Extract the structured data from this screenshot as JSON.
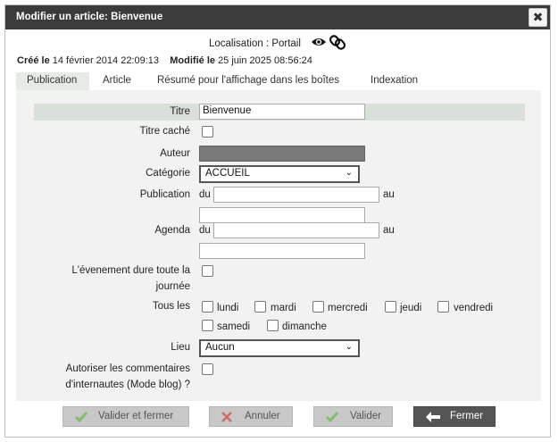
{
  "dialog": {
    "title": "Modifier un article: Bienvenue",
    "close_glyph": "✖",
    "location_text": "Localisation : Portail",
    "created_label": "Créé le",
    "created_value": "14 février 2014 22:09:13",
    "modified_label": "Modifié le",
    "modified_value": "25 juin 2025 08:56:24"
  },
  "tabs": [
    "Publication",
    "Article",
    "Résumé pour l'affichage dans les boîtes",
    "Indexation"
  ],
  "form": {
    "titre_label": "Titre",
    "titre_value": "Bienvenue",
    "titre_cache_label": "Titre caché",
    "auteur_label": "Auteur",
    "categorie_label": "Catégorie",
    "categorie_value": "ACCUEIL",
    "publication_label": "Publication",
    "du": "du",
    "au": "au",
    "agenda_label": "Agenda",
    "evenement_label_1": "L'évenement dure toute la",
    "evenement_label_2": "journée",
    "tous_les_label": "Tous les",
    "days": [
      "lundi",
      "mardi",
      "mercredi",
      "jeudi",
      "vendredi",
      "samedi",
      "dimanche"
    ],
    "lieu_label": "Lieu",
    "lieu_value": "Aucun",
    "comments_label_1": "Autoriser les commentaires",
    "comments_label_2": "d'internautes (Mode blog) ?"
  },
  "buttons": {
    "save_close": "Valider et fermer",
    "cancel": "Annuler",
    "save": "Valider",
    "close": "Fermer"
  },
  "icons": {
    "eye": "eye-icon",
    "link": "link-icon",
    "check": "check-icon",
    "cross": "cross-icon",
    "back_arrow": "back-arrow-icon"
  },
  "colors": {
    "titlebar": "#3b3b3b",
    "panel": "#f2f2f2",
    "highlight_row": "#d9e0d9",
    "button_disabled": "#c8c8c8",
    "button_dark": "#555555",
    "check_green": "#7fbf6a",
    "cross_red": "#d26a6a"
  }
}
